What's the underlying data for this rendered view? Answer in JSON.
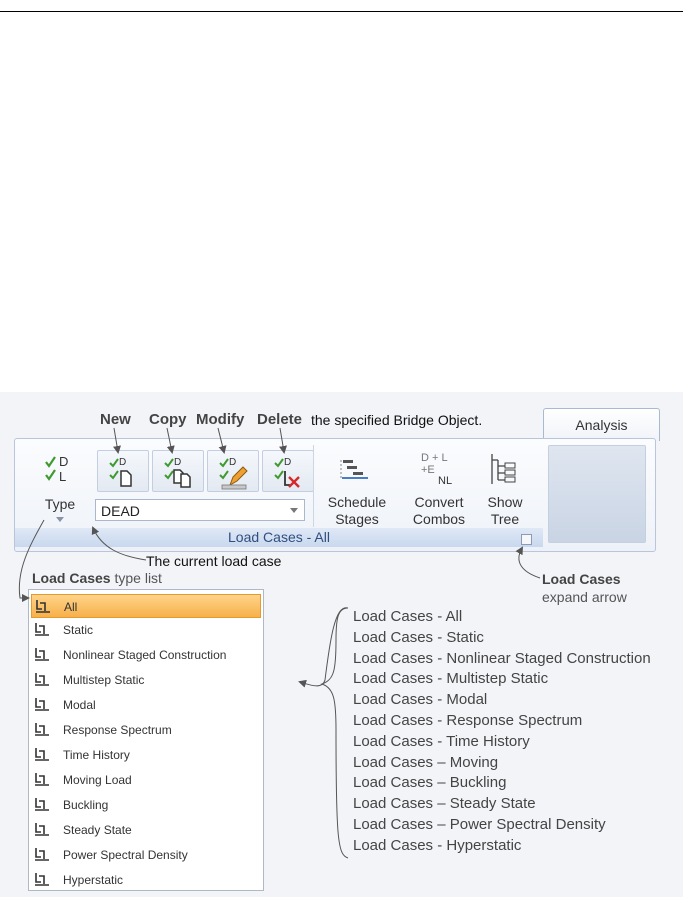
{
  "callouts": {
    "new": "New",
    "copy": "Copy",
    "modify": "Modify",
    "delete": "Delete",
    "specified": "the specified Bridge Object.",
    "current": "The current load case",
    "type_list_bold": "Load Cases",
    "type_list_rest": "type list",
    "expand_bold": "Load Cases",
    "expand_rest": "expand arrow"
  },
  "ribbon": {
    "tab_label": "Analysis",
    "type_label": "Type",
    "combo_value": "DEAD",
    "schedule_line1": "Schedule",
    "schedule_line2": "Stages",
    "convert_line1": "Convert",
    "convert_line2": "Combos",
    "show_line1": "Show",
    "show_line2": "Tree",
    "group_label": "Load Cases - All",
    "icon_D": "D",
    "icon_L": "L",
    "convert_top": "D + L",
    "convert_mid": "+E",
    "convert_nl": "NL"
  },
  "type_list": [
    "All",
    "Static",
    "Nonlinear Staged Construction",
    "Multistep Static",
    "Modal",
    "Response Spectrum",
    "Time History",
    "Moving Load",
    "Buckling",
    "Steady State",
    "Power Spectral Density",
    "Hyperstatic"
  ],
  "group_titles": [
    "Load Cases - All",
    "Load Cases - Static",
    "Load Cases - Nonlinear Staged Construction",
    "Load Cases - Multistep Static",
    "Load Cases - Modal",
    "Load Cases - Response Spectrum",
    "Load Cases - Time History",
    "Load Cases – Moving",
    "Load Cases – Buckling",
    "Load Cases – Steady State",
    "Load Cases – Power Spectral Density",
    "Load Cases - Hyperstatic"
  ],
  "colors": {
    "check_green": "#3f9b2f",
    "selection_orange": "#f7b04a",
    "delete_red": "#d42a2a",
    "group_label_text": "#2f4f7f"
  }
}
